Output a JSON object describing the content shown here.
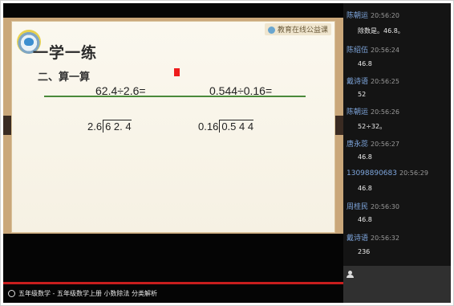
{
  "slide": {
    "brand": "教育在线公益课",
    "heading": "一学一练",
    "subheading": "二、算一算",
    "equations": [
      "62.4÷2.6=",
      "0.544÷0.16="
    ],
    "divisions": [
      {
        "divisor": "2.6",
        "dividend": "6 2. 4"
      },
      {
        "divisor": "0.16",
        "dividend": "0.5 4 4"
      }
    ]
  },
  "caption": "五年级数学 - 五年级数学上册 小数除法 分类解析",
  "chat": {
    "messages": [
      {
        "name": "陈朝运",
        "time": "20:56:20",
        "text": "除数是。46.8。"
      },
      {
        "name": "陈绍伍",
        "time": "20:56:24",
        "text": "46.8"
      },
      {
        "name": "戴诗语",
        "time": "20:56:25",
        "text": "52"
      },
      {
        "name": "陈朝运",
        "time": "20:56:26",
        "text": "52÷32。"
      },
      {
        "name": "唐永蕊",
        "time": "20:56:27",
        "text": "46.8"
      },
      {
        "name": "13098890683",
        "time": "20:56:29",
        "text": "46.8"
      },
      {
        "name": "周桂民",
        "time": "20:56:30",
        "text": "46.8"
      },
      {
        "name": "戴诗语",
        "time": "20:56:32",
        "text": "236"
      }
    ]
  }
}
